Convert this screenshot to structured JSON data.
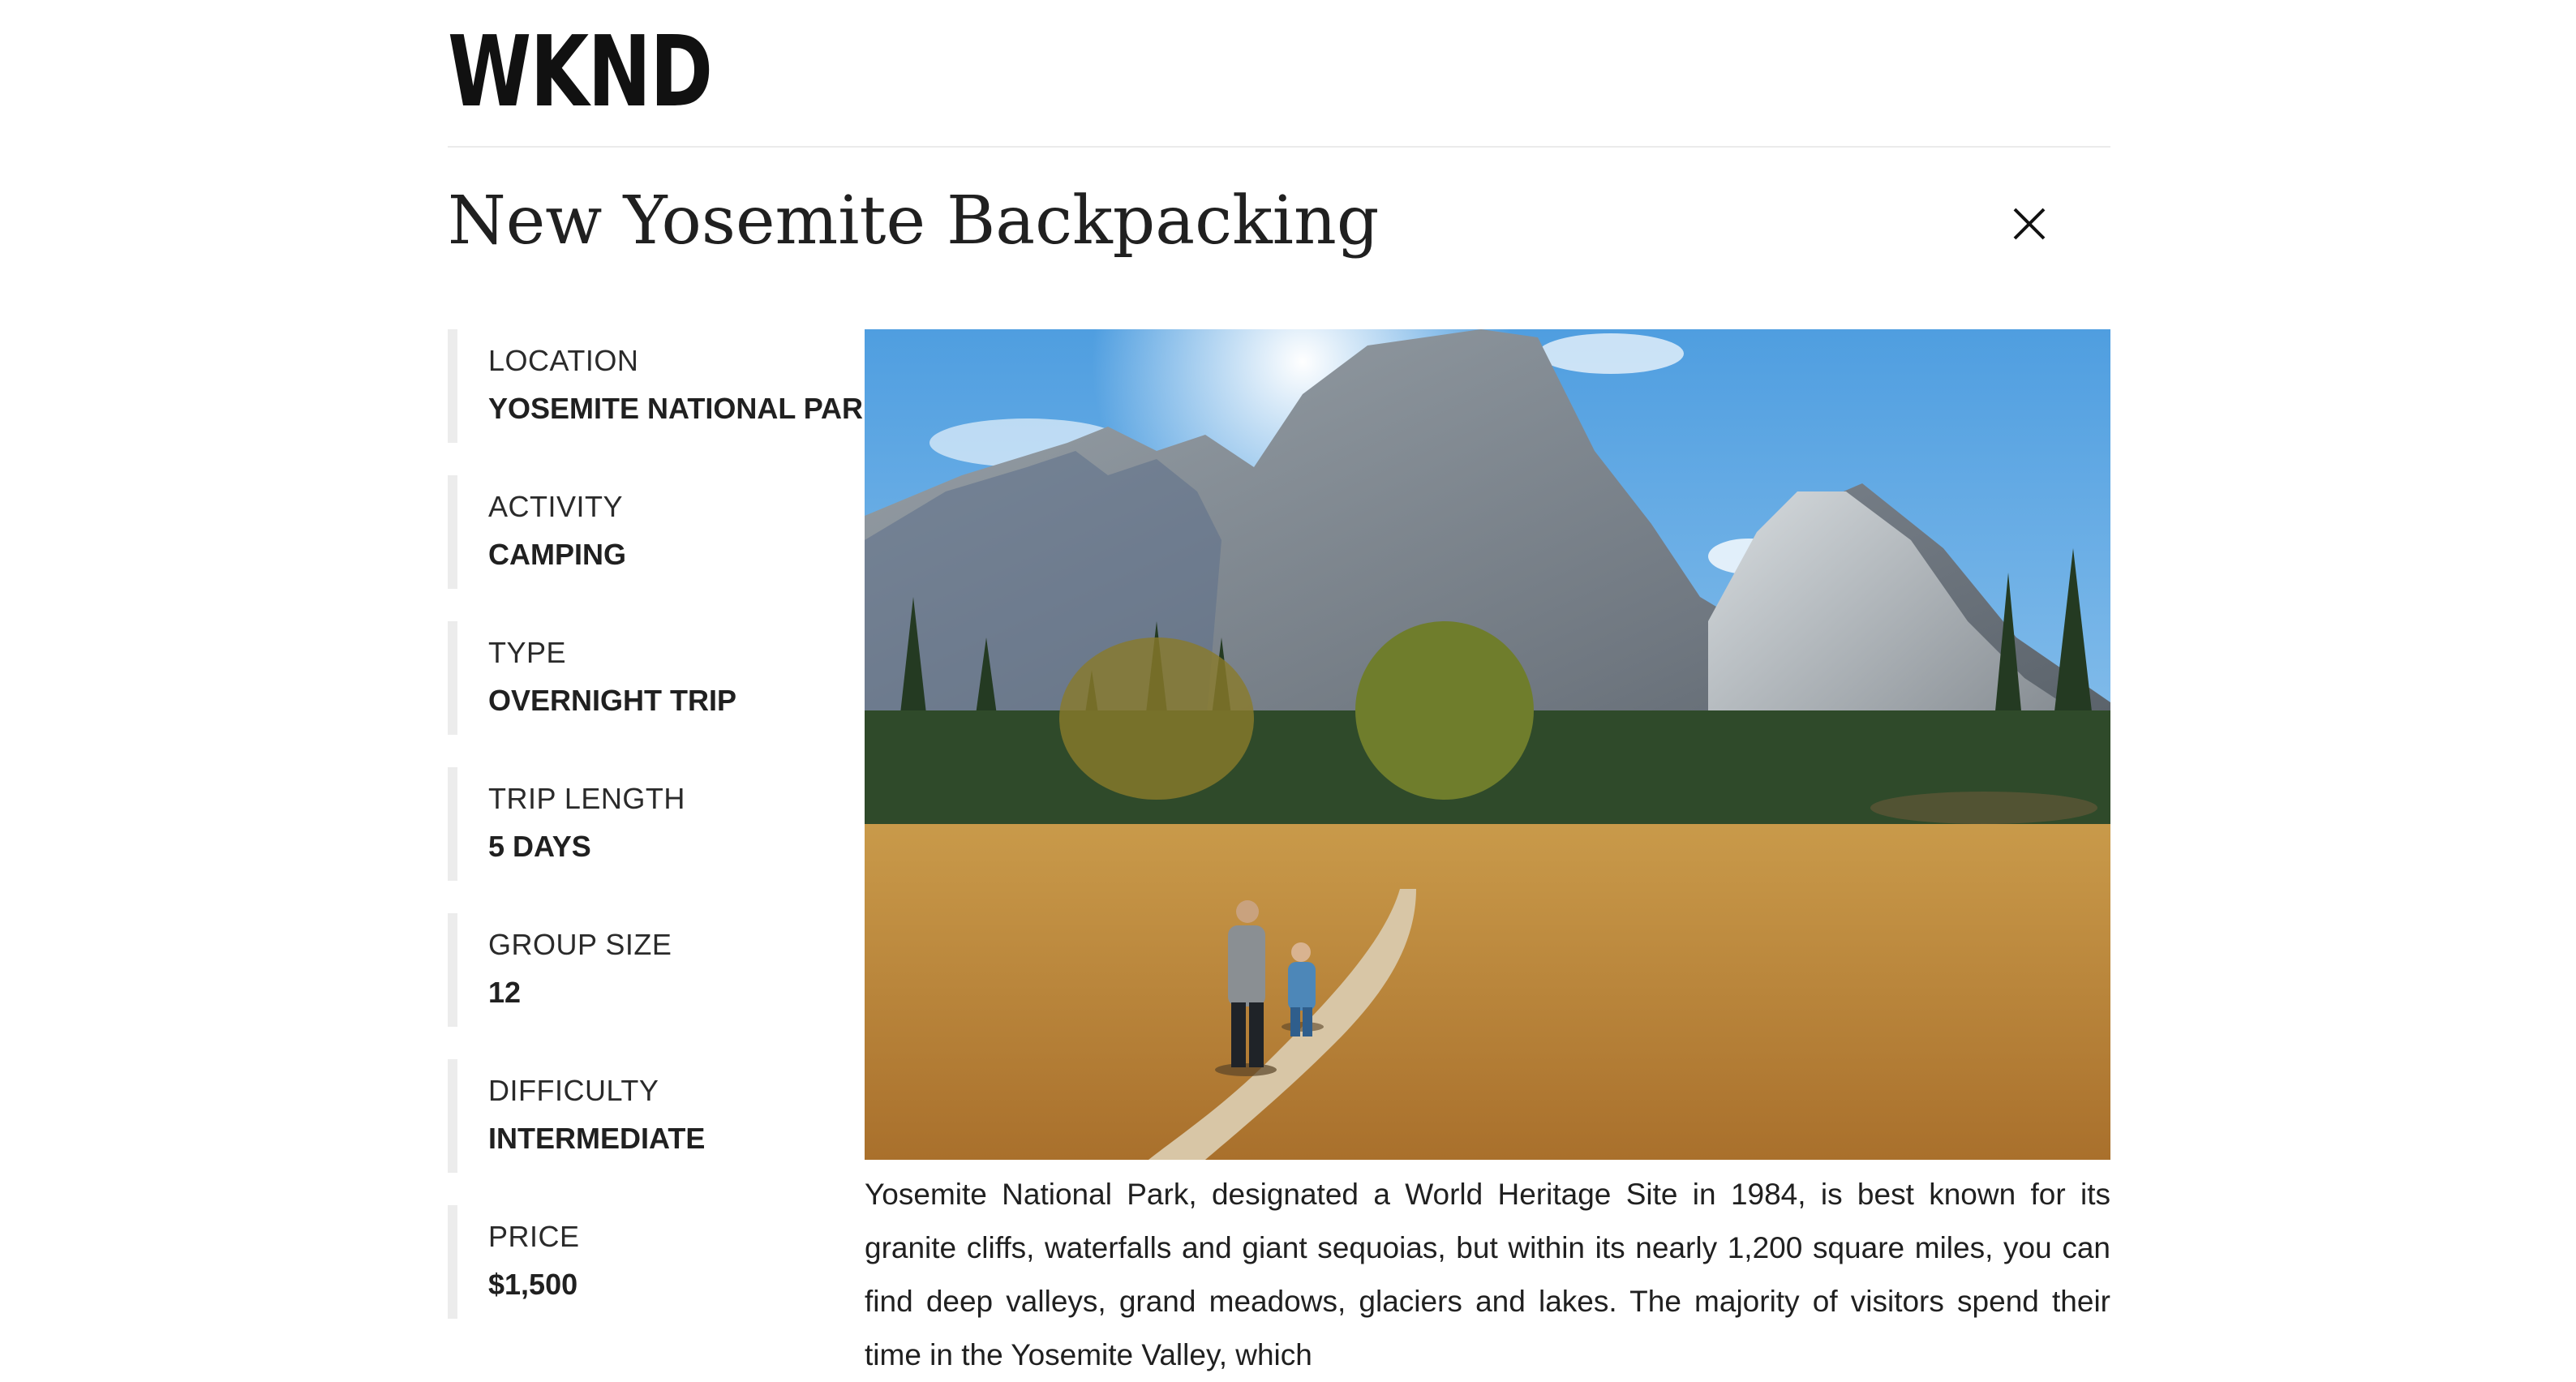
{
  "header": {
    "logo": "WKND"
  },
  "page": {
    "title": "New Yosemite Backpacking",
    "close_icon": "close-icon"
  },
  "details": [
    {
      "label": "LOCATION",
      "value": "YOSEMITE NATIONAL PARK"
    },
    {
      "label": "ACTIVITY",
      "value": "CAMPING"
    },
    {
      "label": "TYPE",
      "value": "OVERNIGHT TRIP"
    },
    {
      "label": "TRIP LENGTH",
      "value": "5 DAYS"
    },
    {
      "label": "GROUP SIZE",
      "value": "12"
    },
    {
      "label": "DIFFICULTY",
      "value": "INTERMEDIATE"
    },
    {
      "label": "PRICE",
      "value": "$1,500"
    }
  ],
  "description": "Yosemite National Park, designated a World Heritage Site in 1984, is best known for its granite cliffs, waterfalls and giant sequoias, but within its nearly 1,200 square miles, you can find deep valleys, grand meadows, glaciers and lakes. The majority of visitors spend their time in the Yosemite Valley, which",
  "colors": {
    "divider": "#ebebeb",
    "detail_border": "#ececec",
    "text": "#202020"
  }
}
